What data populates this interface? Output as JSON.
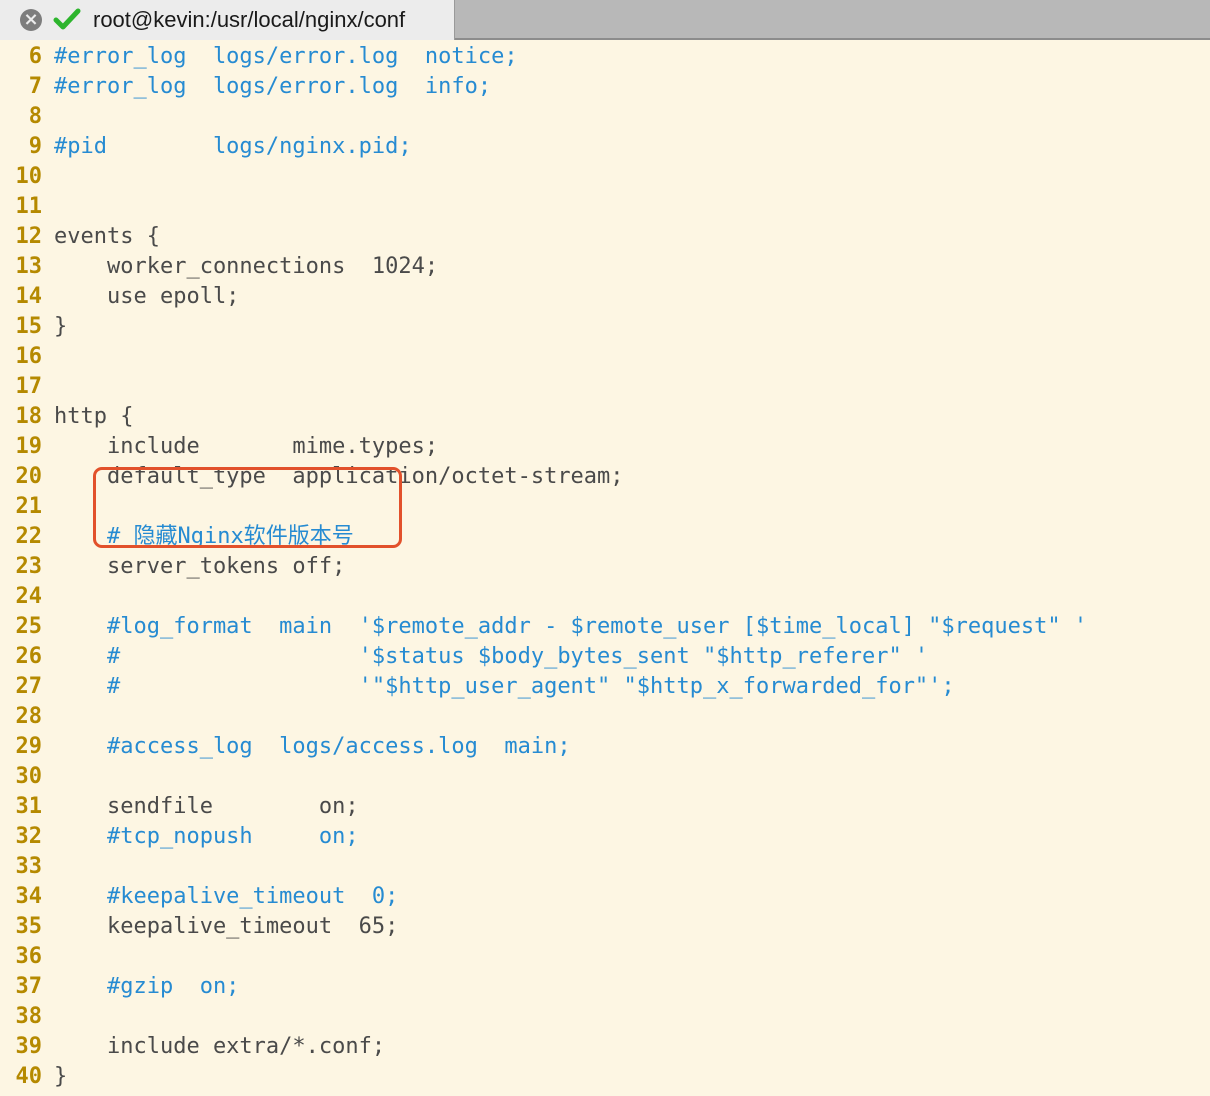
{
  "window": {
    "tab_title": "root@kevin:/usr/local/nginx/conf",
    "close_glyph": "×"
  },
  "colors": {
    "background": "#fdf6e3",
    "line_number": "#b58900",
    "comment": "#268bd2",
    "text": "#4a4a4a",
    "highlight_border": "#e2512b",
    "check_icon": "#2db52d"
  },
  "lines": [
    {
      "num": "6",
      "text": "#error_log  logs/error.log  notice;",
      "kind": "comment"
    },
    {
      "num": "7",
      "text": "#error_log  logs/error.log  info;",
      "kind": "comment"
    },
    {
      "num": "8",
      "text": "",
      "kind": "text"
    },
    {
      "num": "9",
      "text": "#pid        logs/nginx.pid;",
      "kind": "comment"
    },
    {
      "num": "10",
      "text": "",
      "kind": "text"
    },
    {
      "num": "11",
      "text": "",
      "kind": "text"
    },
    {
      "num": "12",
      "text": "events {",
      "kind": "text"
    },
    {
      "num": "13",
      "text": "    worker_connections  1024;",
      "kind": "text"
    },
    {
      "num": "14",
      "text": "    use epoll;",
      "kind": "text"
    },
    {
      "num": "15",
      "text": "}",
      "kind": "text"
    },
    {
      "num": "16",
      "text": "",
      "kind": "text"
    },
    {
      "num": "17",
      "text": "",
      "kind": "text"
    },
    {
      "num": "18",
      "text": "http {",
      "kind": "text"
    },
    {
      "num": "19",
      "text": "    include       mime.types;",
      "kind": "text"
    },
    {
      "num": "20",
      "text": "    default_type  application/octet-stream;",
      "kind": "text"
    },
    {
      "num": "21",
      "text": "",
      "kind": "text"
    },
    {
      "num": "22",
      "text": "    # 隐藏Nginx软件版本号",
      "kind": "comment"
    },
    {
      "num": "23",
      "text": "    server_tokens off;",
      "kind": "text"
    },
    {
      "num": "24",
      "text": "",
      "kind": "text"
    },
    {
      "num": "25",
      "text": "    #log_format  main  '$remote_addr - $remote_user [$time_local] \"$request\" '",
      "kind": "comment"
    },
    {
      "num": "26",
      "text": "    #                  '$status $body_bytes_sent \"$http_referer\" '",
      "kind": "comment"
    },
    {
      "num": "27",
      "text": "    #                  '\"$http_user_agent\" \"$http_x_forwarded_for\"';",
      "kind": "comment"
    },
    {
      "num": "28",
      "text": "",
      "kind": "text"
    },
    {
      "num": "29",
      "text": "    #access_log  logs/access.log  main;",
      "kind": "comment"
    },
    {
      "num": "30",
      "text": "",
      "kind": "text"
    },
    {
      "num": "31",
      "text": "    sendfile        on;",
      "kind": "text"
    },
    {
      "num": "32",
      "text": "    #tcp_nopush     on;",
      "kind": "comment"
    },
    {
      "num": "33",
      "text": "",
      "kind": "text"
    },
    {
      "num": "34",
      "text": "    #keepalive_timeout  0;",
      "kind": "comment"
    },
    {
      "num": "35",
      "text": "    keepalive_timeout  65;",
      "kind": "text"
    },
    {
      "num": "36",
      "text": "",
      "kind": "text"
    },
    {
      "num": "37",
      "text": "    #gzip  on;",
      "kind": "comment"
    },
    {
      "num": "38",
      "text": "",
      "kind": "text"
    },
    {
      "num": "39",
      "text": "    include extra/*.conf;",
      "kind": "text"
    },
    {
      "num": "40",
      "text": "}",
      "kind": "text"
    }
  ]
}
